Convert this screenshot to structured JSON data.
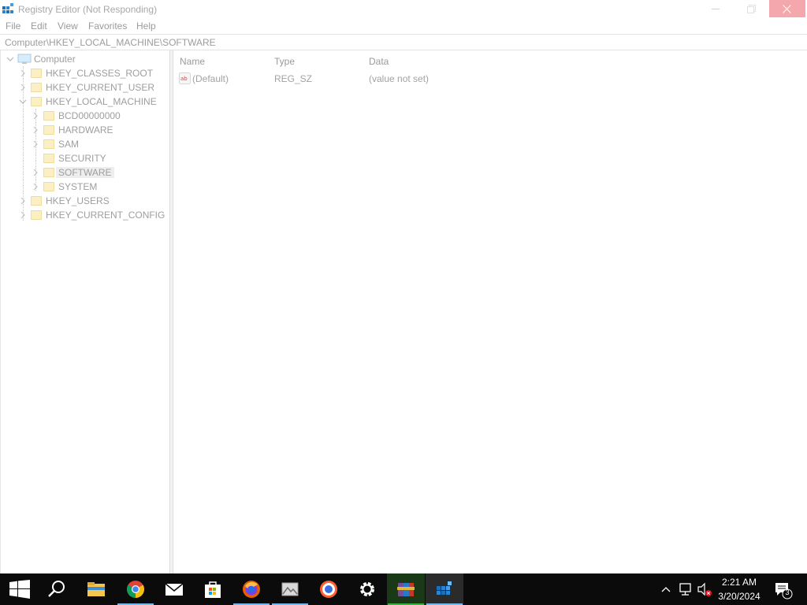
{
  "window": {
    "title": "Registry Editor (Not Responding)",
    "close_color": "#e81123"
  },
  "menu": {
    "items": [
      "File",
      "Edit",
      "View",
      "Favorites",
      "Help"
    ]
  },
  "address": {
    "path": "Computer\\HKEY_LOCAL_MACHINE\\SOFTWARE"
  },
  "tree": {
    "root": "Computer",
    "hives": [
      {
        "label": "HKEY_CLASSES_ROOT"
      },
      {
        "label": "HKEY_CURRENT_USER"
      },
      {
        "label": "HKEY_LOCAL_MACHINE",
        "expanded": true
      },
      {
        "label": "HKEY_USERS"
      },
      {
        "label": "HKEY_CURRENT_CONFIG"
      }
    ],
    "hklm_children": [
      {
        "label": "BCD00000000"
      },
      {
        "label": "HARDWARE"
      },
      {
        "label": "SAM"
      },
      {
        "label": "SECURITY"
      },
      {
        "label": "SOFTWARE",
        "selected": true
      },
      {
        "label": "SYSTEM"
      }
    ]
  },
  "values": {
    "columns": [
      "Name",
      "Type",
      "Data"
    ],
    "rows": [
      {
        "name": "(Default)",
        "type": "REG_SZ",
        "data": "(value not set)",
        "icon": "ab-string-icon"
      }
    ]
  },
  "taskbar": {
    "apps": [
      {
        "name": "start-button",
        "icon": "windows-logo-icon"
      },
      {
        "name": "search-button",
        "icon": "search-icon"
      },
      {
        "name": "file-explorer",
        "icon": "folder-icon"
      },
      {
        "name": "chrome",
        "icon": "chrome-icon"
      },
      {
        "name": "mail",
        "icon": "mail-icon"
      },
      {
        "name": "microsoft-store",
        "icon": "store-icon"
      },
      {
        "name": "firefox",
        "icon": "firefox-icon"
      },
      {
        "name": "photos",
        "icon": "photos-icon"
      },
      {
        "name": "brave",
        "icon": "brave-icon"
      },
      {
        "name": "settings",
        "icon": "gear-icon"
      },
      {
        "name": "winrar",
        "icon": "winrar-icon"
      },
      {
        "name": "registry-editor",
        "icon": "regedit-icon"
      }
    ],
    "accent_color": "#76b9ed",
    "clock_time": "2:21 AM",
    "clock_date": "3/20/2024",
    "notification_count": "3"
  }
}
